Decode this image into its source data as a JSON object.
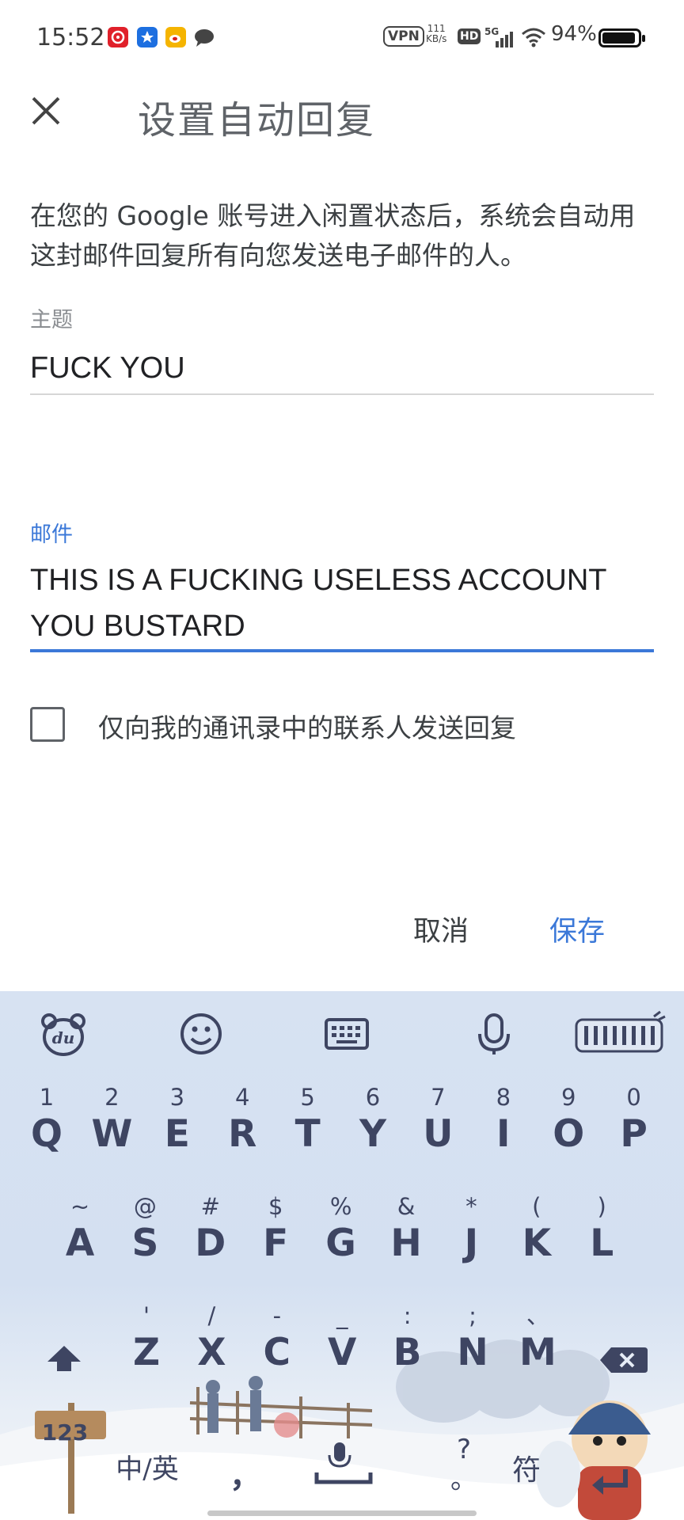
{
  "status_bar": {
    "time": "15:52",
    "vpn": "VPN",
    "speed_value": "111",
    "speed_unit": "KB/s",
    "hd": "HD",
    "network": "5G",
    "battery": "94%",
    "battery_level": 0.94,
    "app_icons": [
      "netease-music-icon",
      "app-store-icon",
      "weibo-icon",
      "message-bubble-icon"
    ]
  },
  "header": {
    "title": "设置自动回复",
    "close_icon": "close-icon"
  },
  "description": "在您的 Google 账号进入闲置状态后，系统会自动用这封邮件回复所有向您发送电子邮件的人。",
  "subject": {
    "label": "主题",
    "value": "FUCK YOU"
  },
  "body": {
    "label": "邮件",
    "value_line1": "THIS IS A FUCKING USELESS ACCOUNT",
    "value_line2": "YOU BUSTARD"
  },
  "checkbox": {
    "label": "仅向我的通讯录中的联系人发送回复",
    "checked": false
  },
  "actions": {
    "cancel": "取消",
    "save": "保存"
  },
  "colors": {
    "accent": "#3b78d8",
    "keyboard_bg": "#d7e2f2",
    "key_text": "#3e4562"
  },
  "keyboard": {
    "toolbar": [
      "du-bear-icon",
      "emoji-icon",
      "keyboard-icon",
      "microphone-icon",
      "keepy-logo-icon"
    ],
    "row1": [
      {
        "sub": "1",
        "main": "Q"
      },
      {
        "sub": "2",
        "main": "W"
      },
      {
        "sub": "3",
        "main": "E"
      },
      {
        "sub": "4",
        "main": "R"
      },
      {
        "sub": "5",
        "main": "T"
      },
      {
        "sub": "6",
        "main": "Y"
      },
      {
        "sub": "7",
        "main": "U"
      },
      {
        "sub": "8",
        "main": "I"
      },
      {
        "sub": "9",
        "main": "O"
      },
      {
        "sub": "0",
        "main": "P"
      }
    ],
    "row2": [
      {
        "sub": "~",
        "main": "A"
      },
      {
        "sub": "@",
        "main": "S"
      },
      {
        "sub": "#",
        "main": "D"
      },
      {
        "sub": "$",
        "main": "F"
      },
      {
        "sub": "%",
        "main": "G"
      },
      {
        "sub": "&",
        "main": "H"
      },
      {
        "sub": "*",
        "main": "J"
      },
      {
        "sub": "(",
        "main": "K"
      },
      {
        "sub": ")",
        "main": "L"
      }
    ],
    "row3": [
      {
        "sub": "'",
        "main": "Z"
      },
      {
        "sub": "/",
        "main": "X"
      },
      {
        "sub": "-",
        "main": "C"
      },
      {
        "sub": "_",
        "main": "V"
      },
      {
        "sub": ":",
        "main": "B"
      },
      {
        "sub": ";",
        "main": "N"
      },
      {
        "sub": "、",
        "main": "M"
      }
    ],
    "num_key": "123",
    "lang_key": "中/英",
    "comma": "，",
    "question": "?",
    "period": "。",
    "symbol_key": "符"
  }
}
